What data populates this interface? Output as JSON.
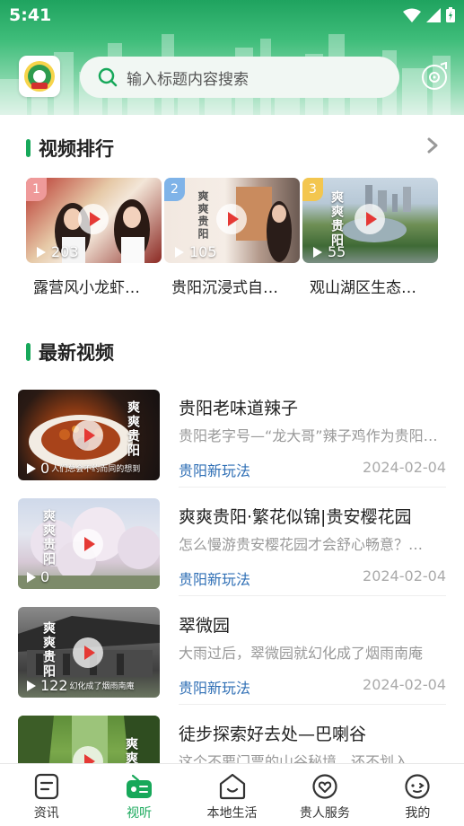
{
  "status_bar": {
    "time": "5:41"
  },
  "header": {
    "search_placeholder": "输入标题内容搜索"
  },
  "ranking": {
    "title": "视频排行",
    "items": [
      {
        "rank": "1",
        "views": "203",
        "title": "露营风小龙虾…"
      },
      {
        "rank": "2",
        "views": "105",
        "title": "贵阳沉浸式自…"
      },
      {
        "rank": "3",
        "views": "55",
        "title": "观山湖区生态…"
      }
    ]
  },
  "latest": {
    "title": "最新视频",
    "items": [
      {
        "title": "贵阳老味道辣子",
        "desc": "贵阳老字号—“龙大哥”辣子鸡作为贵阳…",
        "source": "贵阳新玩法",
        "date": "2024-02-04",
        "views": "0"
      },
      {
        "title": "爽爽贵阳·繁花似锦|贵安樱花园",
        "desc": "怎么慢游贵安樱花园才会舒心畅意？…",
        "source": "贵阳新玩法",
        "date": "2024-02-04",
        "views": "0"
      },
      {
        "title": "翠微园",
        "desc": "大雨过后，翠微园就幻化成了烟雨南庵",
        "source": "贵阳新玩法",
        "date": "2024-02-04",
        "views": "122"
      },
      {
        "title": "徒步探索好去处—巴喇谷",
        "desc": "这个不要门票的山谷秘境，还不划入…"
      }
    ]
  },
  "thumb_text": {
    "brand_vertical": "爽爽贵阳",
    "caption_1": "人们总会不约而同的想到",
    "caption_3": "幻化成了烟雨南庵"
  },
  "tabs": [
    {
      "label": "资讯",
      "icon": "news-icon"
    },
    {
      "label": "视听",
      "icon": "radio-icon",
      "active": true
    },
    {
      "label": "本地生活",
      "icon": "local-life-icon"
    },
    {
      "label": "贵人服务",
      "icon": "service-icon"
    },
    {
      "label": "我的",
      "icon": "profile-icon"
    }
  ],
  "colors": {
    "brand_green": "#17a85a",
    "source_blue": "#2f6fb5",
    "play_red": "#e53935"
  }
}
